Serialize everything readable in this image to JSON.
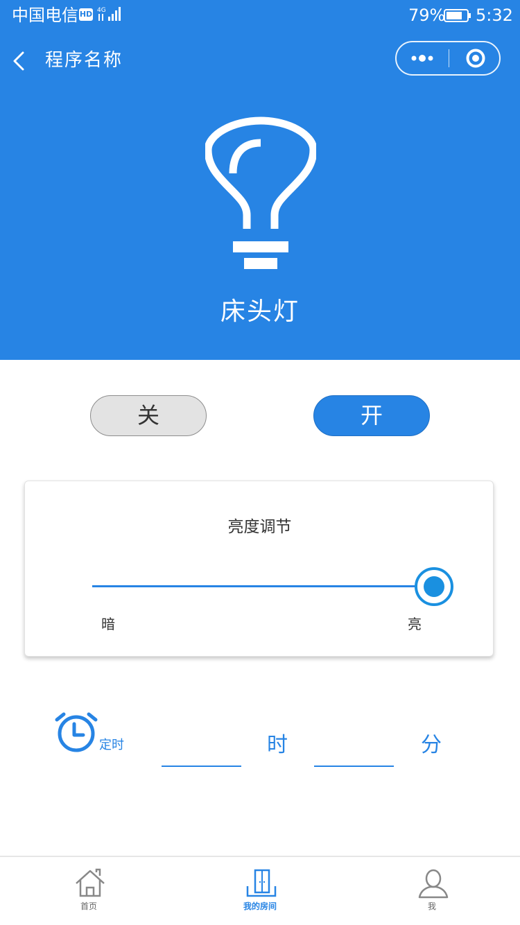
{
  "status_bar": {
    "carrier": "中国电信",
    "hd_badge": "HD",
    "network": "4G",
    "battery_percent": "79%",
    "battery_level": 0.79,
    "time": "5:32"
  },
  "nav": {
    "title": "程序名称",
    "back_icon": "chevron-left-icon",
    "menu_icon": "more-dots-icon",
    "close_icon": "target-circle-icon"
  },
  "device": {
    "icon": "lightbulb-icon",
    "name": "床头灯"
  },
  "controls": {
    "off_label": "关",
    "on_label": "开"
  },
  "brightness": {
    "title": "亮度调节",
    "min_label": "暗",
    "max_label": "亮",
    "level": 1.0
  },
  "timer": {
    "icon": "alarm-clock-icon",
    "label": "定时",
    "hour_value": "",
    "hour_unit": "时",
    "minute_value": "",
    "minute_unit": "分"
  },
  "tabbar": {
    "items": [
      {
        "label": "首页",
        "icon": "home-icon",
        "active": false
      },
      {
        "label": "我的房间",
        "icon": "room-door-icon",
        "active": true
      },
      {
        "label": "我",
        "icon": "user-icon",
        "active": false
      }
    ]
  },
  "colors": {
    "primary": "#2784e4",
    "slider_thumb": "#1a90e0",
    "off_button_bg": "#e3e3e3",
    "inactive_tab": "#666666"
  }
}
